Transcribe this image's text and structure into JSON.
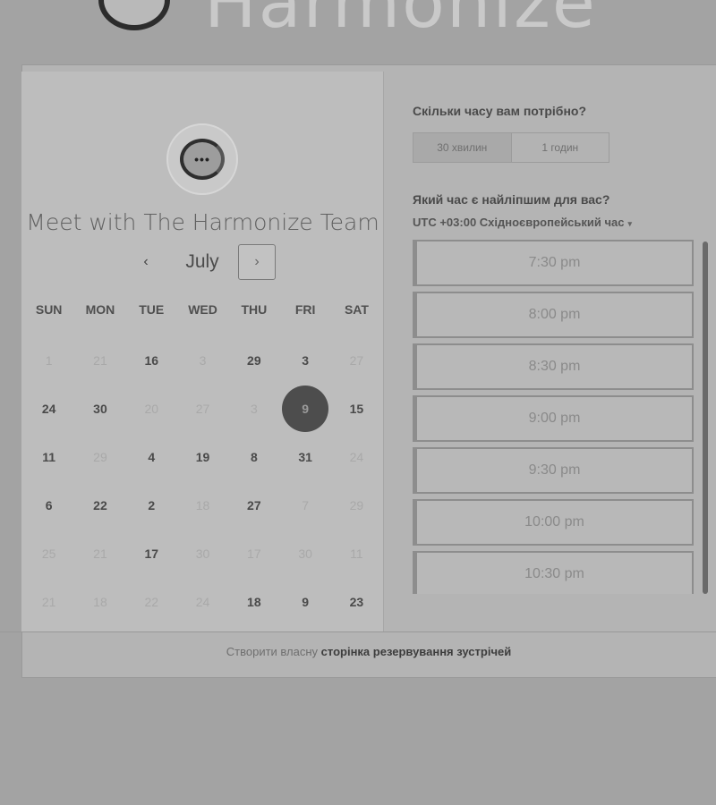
{
  "brand": {
    "name": "Harmonize",
    "logo_icon": "chat-bubble-logo"
  },
  "meeting": {
    "title": "Meet with The Harmonize Team",
    "avatar_text": "•••"
  },
  "calendar": {
    "month": "July",
    "prev_icon": "‹",
    "next_icon": "›",
    "weekdays": [
      "SUN",
      "MON",
      "TUE",
      "WED",
      "THU",
      "FRI",
      "SAT"
    ],
    "selected": "9",
    "rows": [
      [
        {
          "d": "1",
          "a": false
        },
        {
          "d": "21",
          "a": false
        },
        {
          "d": "16",
          "a": true
        },
        {
          "d": "3",
          "a": false
        },
        {
          "d": "29",
          "a": true
        },
        {
          "d": "3",
          "a": true
        },
        {
          "d": "27",
          "a": false
        }
      ],
      [
        {
          "d": "24",
          "a": true
        },
        {
          "d": "30",
          "a": true
        },
        {
          "d": "20",
          "a": false
        },
        {
          "d": "27",
          "a": false
        },
        {
          "d": "3",
          "a": false
        },
        {
          "d": "9",
          "a": true,
          "s": true
        },
        {
          "d": "15",
          "a": true
        }
      ],
      [
        {
          "d": "11",
          "a": true
        },
        {
          "d": "29",
          "a": false
        },
        {
          "d": "4",
          "a": true
        },
        {
          "d": "19",
          "a": true
        },
        {
          "d": "8",
          "a": true
        },
        {
          "d": "31",
          "a": true
        },
        {
          "d": "24",
          "a": false
        }
      ],
      [
        {
          "d": "6",
          "a": true
        },
        {
          "d": "22",
          "a": true
        },
        {
          "d": "2",
          "a": true
        },
        {
          "d": "18",
          "a": false
        },
        {
          "d": "27",
          "a": true
        },
        {
          "d": "7",
          "a": false
        },
        {
          "d": "29",
          "a": false
        }
      ],
      [
        {
          "d": "25",
          "a": false
        },
        {
          "d": "21",
          "a": false
        },
        {
          "d": "17",
          "a": true
        },
        {
          "d": "30",
          "a": false
        },
        {
          "d": "17",
          "a": false
        },
        {
          "d": "30",
          "a": false
        },
        {
          "d": "11",
          "a": false
        }
      ],
      [
        {
          "d": "21",
          "a": false
        },
        {
          "d": "18",
          "a": false
        },
        {
          "d": "22",
          "a": false
        },
        {
          "d": "24",
          "a": false
        },
        {
          "d": "18",
          "a": true
        },
        {
          "d": "9",
          "a": true
        },
        {
          "d": "23",
          "a": true
        }
      ]
    ]
  },
  "booking": {
    "duration_question": "Скільки часу вам потрібно?",
    "durations": [
      {
        "label": "30 хвилин",
        "active": true
      },
      {
        "label": "1 годин",
        "active": false
      }
    ],
    "time_question": "Який час є найліпшим для вас?",
    "timezone": "UTC +03:00 Східноєвропейський час",
    "timezone_caret": "▾",
    "slots": [
      "7:30 pm",
      "8:00 pm",
      "8:30 pm",
      "9:00 pm",
      "9:30 pm",
      "10:00 pm",
      "10:30 pm"
    ]
  },
  "footer": {
    "prefix": "Створити власну",
    "link": "сторінка резервування зустрічей"
  }
}
